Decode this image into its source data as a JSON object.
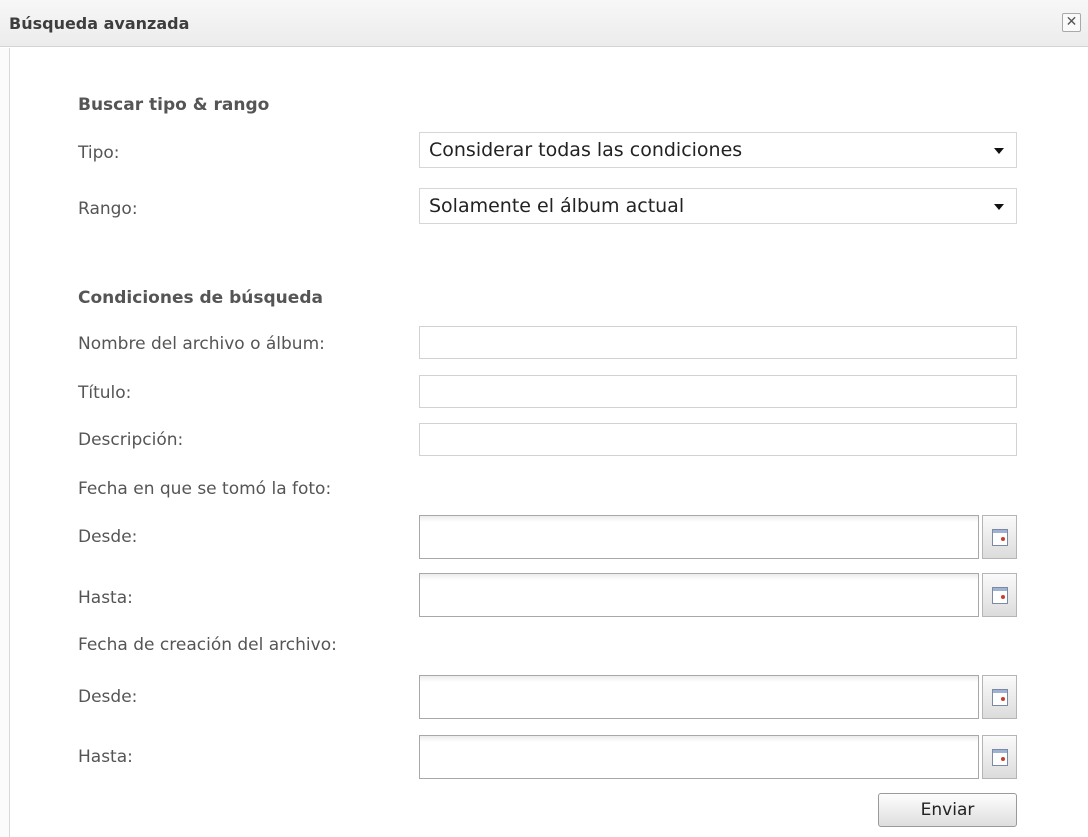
{
  "dialog": {
    "title": "Búsqueda avanzada",
    "close_label": "✕"
  },
  "type_range": {
    "heading": "Buscar tipo & rango",
    "type_label": "Tipo:",
    "type_value": "Considerar todas las condiciones",
    "range_label": "Rango:",
    "range_value": "Solamente el álbum actual"
  },
  "conditions": {
    "heading": "Condiciones de búsqueda",
    "filename_label": "Nombre del archivo o álbum:",
    "filename_value": "",
    "title_label": "Título:",
    "title_value": "",
    "description_label": "Descripción:",
    "description_value": "",
    "photo_date_label": "Fecha en que se tomó la foto:",
    "photo_from_label": "Desde:",
    "photo_from_value": "",
    "photo_to_label": "Hasta:",
    "photo_to_value": "",
    "file_date_label": "Fecha de creación del archivo:",
    "file_from_label": "Desde:",
    "file_from_value": "",
    "file_to_label": "Hasta:",
    "file_to_value": ""
  },
  "actions": {
    "submit_label": "Enviar"
  }
}
